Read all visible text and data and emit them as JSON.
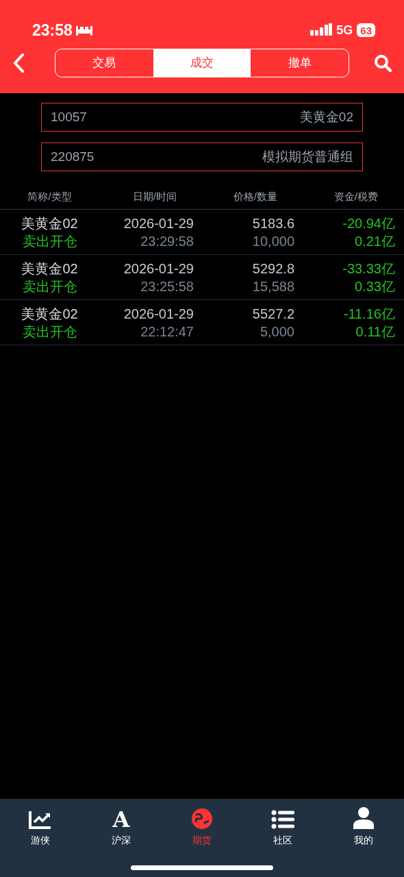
{
  "status_bar": {
    "time": "23:58",
    "network": "5G",
    "battery": "63"
  },
  "tabs": [
    {
      "label": "交易",
      "selected": false
    },
    {
      "label": "成交",
      "selected": true
    },
    {
      "label": "撤单",
      "selected": false
    }
  ],
  "account": {
    "id": "10057",
    "name": "美黄金02"
  },
  "group": {
    "id": "220875",
    "name": "模拟期货普通组"
  },
  "table": {
    "columns": [
      "简称/类型",
      "日期/时间",
      "价格/数量",
      "资金/税费"
    ],
    "rows": [
      {
        "name": "美黄金02",
        "type": "卖出开仓",
        "date": "2026-01-29",
        "time": "23:29:58",
        "price": "5183.6",
        "quantity": "10,000",
        "amount": "-20.94亿",
        "fee": "0.21亿"
      },
      {
        "name": "美黄金02",
        "type": "卖出开仓",
        "date": "2026-01-29",
        "time": "23:25:58",
        "price": "5292.8",
        "quantity": "15,588",
        "amount": "-33.33亿",
        "fee": "0.33亿"
      },
      {
        "name": "美黄金02",
        "type": "卖出开仓",
        "date": "2026-01-29",
        "time": "22:12:47",
        "price": "5527.2",
        "quantity": "5,000",
        "amount": "-11.16亿",
        "fee": "0.11亿"
      }
    ]
  },
  "nav": [
    {
      "kind": "chart",
      "label": "游侠",
      "selected": false
    },
    {
      "kind": "letter",
      "glyph": "A",
      "label": "沪深",
      "selected": false
    },
    {
      "kind": "globe",
      "label": "期货",
      "selected": true
    },
    {
      "kind": "list",
      "label": "社区",
      "selected": false
    },
    {
      "kind": "person",
      "label": "我的",
      "selected": false
    }
  ]
}
